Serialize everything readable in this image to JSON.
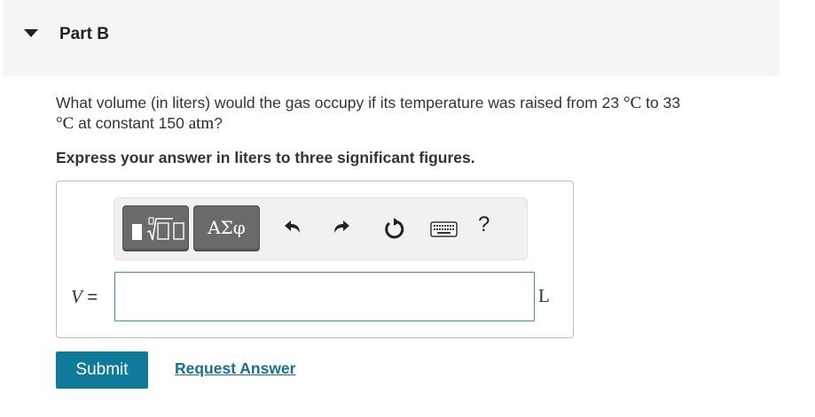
{
  "part": {
    "title": "Part B"
  },
  "question": {
    "text_before": "What volume (in liters) would the gas occupy if its temperature was raised from 23 ",
    "temp1_unit": "°C",
    "text_mid1": " to 33 ",
    "temp2_unit": "°C",
    "text_mid2": " at constant 150 ",
    "pressure_unit": "atm",
    "text_after": "?"
  },
  "instruction": "Express your answer in liters to three significant figures.",
  "toolbar": {
    "greek_label": "ΑΣφ",
    "help_label": "?"
  },
  "answer": {
    "variable": "V",
    "equals": " =",
    "value": "",
    "unit": "L"
  },
  "actions": {
    "submit_label": "Submit",
    "request_label": "Request Answer"
  },
  "colors": {
    "accent": "#0f7a99",
    "link": "#1a6f91",
    "header_bg": "#f5f5f5"
  }
}
